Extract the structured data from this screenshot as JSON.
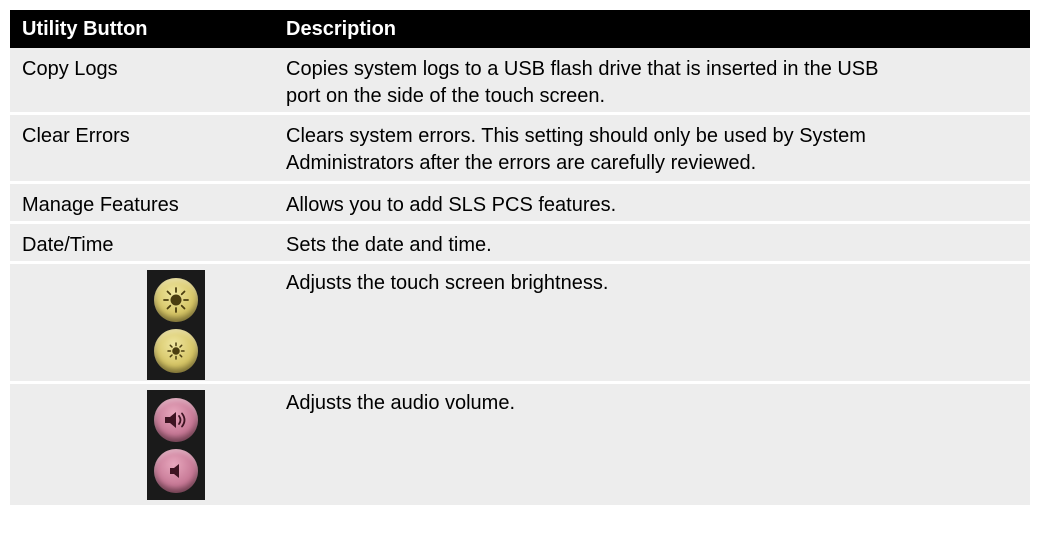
{
  "header": {
    "col1": "Utility Button",
    "col2": "Description"
  },
  "rows": [
    {
      "button": "Copy Logs",
      "description_line1": "Copies system logs to a USB flash drive that is inserted in the USB",
      "description_line2": "port on the side of the touch screen."
    },
    {
      "button": "Clear Errors",
      "description_line1": "Clears system errors. This setting should only be used by System",
      "description_line2": "Administrators after the errors are carefully reviewed."
    },
    {
      "button": "Manage Features",
      "description": "Allows you to add SLS PCS features."
    },
    {
      "button": "Date/Time",
      "description": "Sets the date and time."
    },
    {
      "icons": [
        "brightness-up-icon",
        "brightness-down-icon"
      ],
      "description": "Adjusts the touch screen brightness."
    },
    {
      "icons": [
        "volume-up-icon",
        "volume-down-icon"
      ],
      "description": "Adjusts the audio volume."
    }
  ],
  "colors": {
    "header_bg": "#000000",
    "row_bg": "#ededed",
    "brightness_button": "#d6c566",
    "volume_button": "#c77996"
  }
}
